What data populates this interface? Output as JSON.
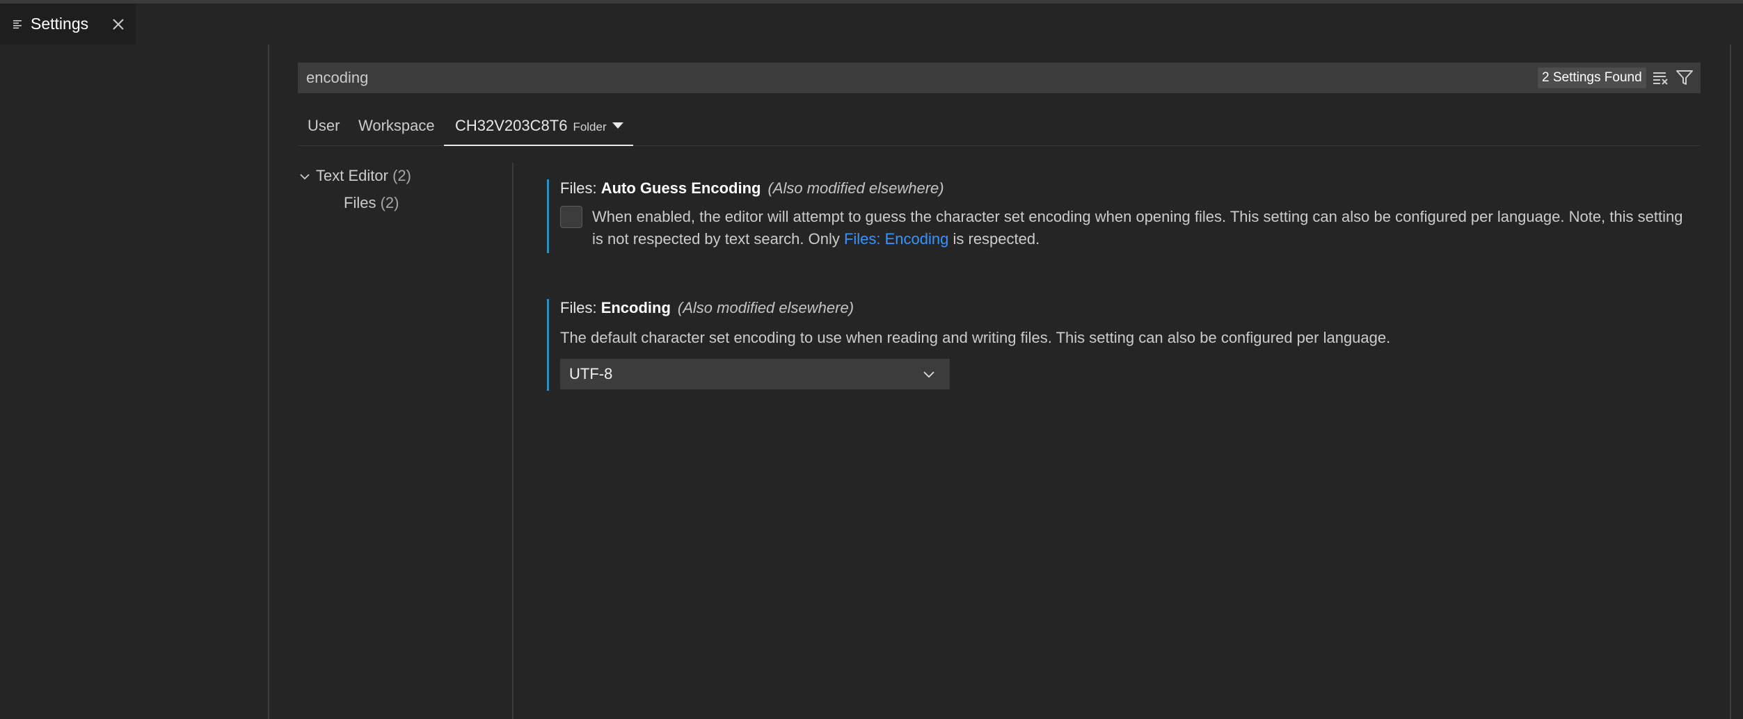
{
  "tab": {
    "icon": "settings-editor-icon",
    "label": "Settings",
    "close_icon": "close-icon"
  },
  "search": {
    "value": "encoding",
    "results_badge": "2 Settings Found",
    "clear_filter_icon": "clear-filter-icon",
    "filter_icon": "filter-icon"
  },
  "scopes": {
    "user": "User",
    "workspace": "Workspace",
    "folder_name": "CH32V203C8T6",
    "folder_label": "Folder"
  },
  "toc": {
    "text_editor": "Text Editor",
    "text_editor_count": "(2)",
    "files": "Files",
    "files_count": "(2)"
  },
  "settings": [
    {
      "category": "Files: ",
      "name": "Auto Guess Encoding",
      "modified": "(Also modified elsewhere)",
      "checked": false,
      "desc_before": "When enabled, the editor will attempt to guess the character set encoding when opening files. This setting can also be configured per language. Note, this setting is not respected by text search. Only ",
      "desc_link": "Files: Encoding",
      "desc_after": " is respected."
    },
    {
      "category": "Files: ",
      "name": "Encoding",
      "modified": "(Also modified elsewhere)",
      "description": "The default character set encoding to use when reading and writing files. This setting can also be configured per language.",
      "selected": "UTF-8"
    }
  ],
  "colors": {
    "background": "#252526",
    "accent_border": "#2f8fbd",
    "link": "#3794ff"
  }
}
